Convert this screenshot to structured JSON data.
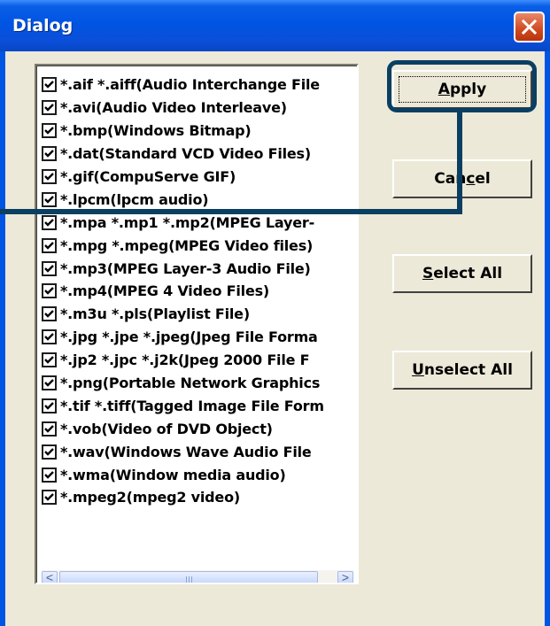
{
  "window": {
    "title": "Dialog"
  },
  "file_types": [
    {
      "label": "*.aif *.aiff(Audio Interchange File",
      "checked": true
    },
    {
      "label": "*.avi(Audio Video Interleave)",
      "checked": true
    },
    {
      "label": "*.bmp(Windows Bitmap)",
      "checked": true
    },
    {
      "label": "*.dat(Standard VCD Video Files)",
      "checked": true
    },
    {
      "label": "*.gif(CompuServe GIF)",
      "checked": true
    },
    {
      "label": "*.lpcm(lpcm audio)",
      "checked": true
    },
    {
      "label": "*.mpa *.mp1 *.mp2(MPEG Layer-",
      "checked": true
    },
    {
      "label": "*.mpg *.mpeg(MPEG Video files)",
      "checked": true
    },
    {
      "label": "*.mp3(MPEG Layer-3 Audio File)",
      "checked": true
    },
    {
      "label": "*.mp4(MPEG 4 Video Files)",
      "checked": true
    },
    {
      "label": "*.m3u *.pls(Playlist File)",
      "checked": true
    },
    {
      "label": "*.jpg *.jpe *.jpeg(Jpeg File Forma",
      "checked": true
    },
    {
      "label": "*.jp2 *.jpc *.j2k(Jpeg 2000 File F",
      "checked": true
    },
    {
      "label": "*.png(Portable Network Graphics",
      "checked": true
    },
    {
      "label": "*.tif *.tiff(Tagged Image File Form",
      "checked": true
    },
    {
      "label": "*.vob(Video of DVD Object)",
      "checked": true
    },
    {
      "label": "*.wav(Windows Wave Audio File",
      "checked": true
    },
    {
      "label": "*.wma(Window media audio)",
      "checked": true
    },
    {
      "label": "*.mpeg2(mpeg2 video)",
      "checked": true
    }
  ],
  "buttons": {
    "apply": {
      "mnemonic": "A",
      "rest": "pply"
    },
    "cancel": {
      "before": "Can",
      "mnemonic": "c",
      "rest": "el"
    },
    "select_all": {
      "mnemonic": "S",
      "rest": "elect All"
    },
    "unselect_all": {
      "mnemonic": "U",
      "rest": "nselect All"
    }
  },
  "scrollbar": {
    "left_arrow": "<",
    "right_arrow": ">"
  },
  "colors": {
    "titlebar": "#0054e3",
    "close_button": "#d04a20",
    "dialog_face": "#ece9d8",
    "callout": "#0a3f62"
  },
  "icons": {
    "close": "close-icon",
    "checkbox": "checkmark-icon",
    "scroll_left": "arrow-left-icon",
    "scroll_right": "arrow-right-icon"
  }
}
